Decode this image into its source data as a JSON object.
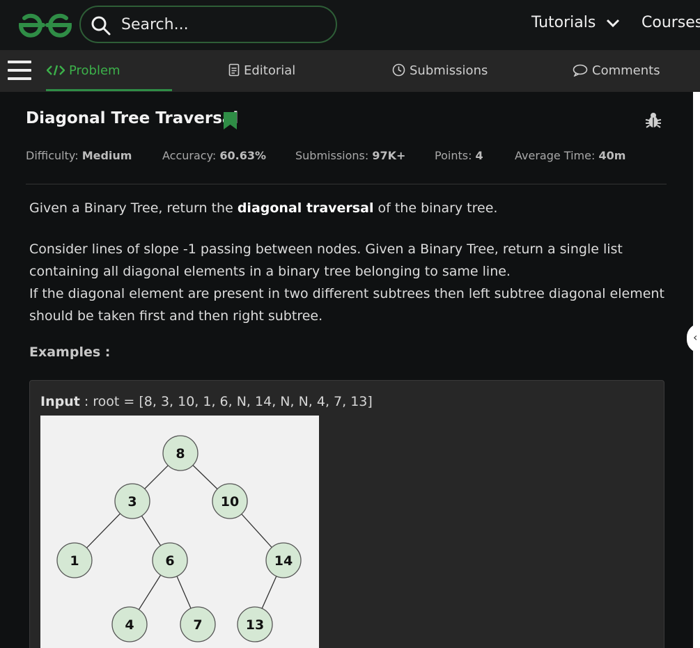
{
  "header": {
    "search_placeholder": "Search...",
    "nav": [
      {
        "label": "Tutorials"
      },
      {
        "label": "Courses"
      }
    ]
  },
  "tabs": [
    {
      "label": "Problem",
      "icon": "code-icon",
      "active": true
    },
    {
      "label": "Editorial",
      "icon": "document-icon",
      "active": false
    },
    {
      "label": "Submissions",
      "icon": "clock-icon",
      "active": false
    },
    {
      "label": "Comments",
      "icon": "comment-icon",
      "active": false
    }
  ],
  "problem": {
    "title": "Diagonal Tree Traversal",
    "meta": {
      "difficulty_label": "Difficulty:",
      "difficulty_value": "Medium",
      "accuracy_label": "Accuracy:",
      "accuracy_value": "60.63%",
      "submissions_label": "Submissions:",
      "submissions_value": "97K+",
      "points_label": "Points:",
      "points_value": "4",
      "avg_time_label": "Average Time:",
      "avg_time_value": "40m"
    },
    "intro_before": "Given a Binary Tree, return the ",
    "intro_bold": "diagonal traversal",
    "intro_after": " of the binary tree.",
    "description_line1": "Consider lines of slope -1 passing between nodes. Given a Binary Tree, return a single list containing all diagonal elements in a binary tree belonging to same line.",
    "description_line2": "If the diagonal element are present in two different subtrees then left subtree diagonal element should be taken first and then right subtree.",
    "examples_heading": "Examples :",
    "example": {
      "input_label": "Input",
      "input_value": " : root = [8, 3, 10, 1, 6, N, 14, N, N, 4, 7, 13]",
      "tree_nodes": [
        "8",
        "3",
        "10",
        "1",
        "6",
        "14",
        "4",
        "7",
        "13"
      ]
    }
  },
  "colors": {
    "accent": "#2f8d46",
    "node_fill": "#d5e8d4",
    "background": "#0f1112"
  }
}
